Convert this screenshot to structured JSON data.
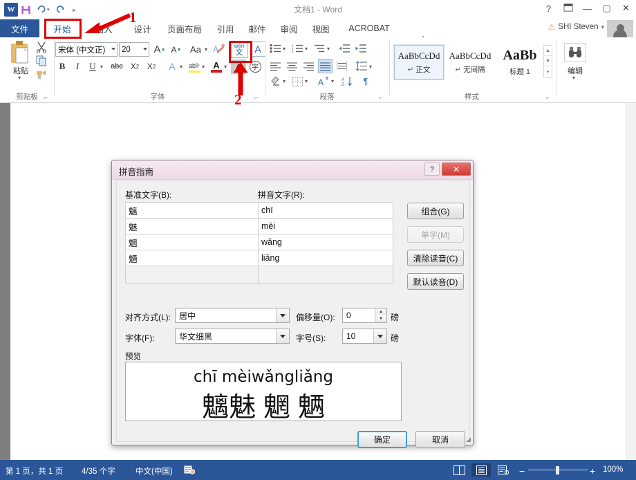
{
  "titlebar": {
    "app_logo": "W",
    "doc_title": "文档1 - Word",
    "qat": [
      {
        "name": "save",
        "glyph": "■"
      },
      {
        "name": "undo",
        "glyph": "↶"
      },
      {
        "name": "redo",
        "glyph": "↻"
      },
      {
        "name": "customize",
        "glyph": "≡"
      }
    ],
    "window_controls": [
      {
        "name": "help",
        "glyph": "?"
      },
      {
        "name": "ribbon-display-options",
        "glyph": "□"
      },
      {
        "name": "minimize",
        "glyph": "—"
      },
      {
        "name": "maximize",
        "glyph": "□"
      },
      {
        "name": "close",
        "glyph": "✕"
      }
    ]
  },
  "tabs": {
    "file": "文件",
    "items": [
      "开始",
      "插入",
      "设计",
      "页面布局",
      "引用",
      "邮件",
      "审阅",
      "视图",
      "ACROBAT"
    ],
    "active": "开始",
    "account_name": "SHI Steven",
    "account_caret": "▾"
  },
  "ribbon": {
    "groups": [
      {
        "name": "clipboard",
        "label": "剪贴板"
      },
      {
        "name": "font",
        "label": "字体"
      },
      {
        "name": "paragraph",
        "label": "段落"
      },
      {
        "name": "styles",
        "label": "样式"
      },
      {
        "name": "editing",
        "label": "编辑"
      }
    ],
    "clipboard": {
      "paste_label": "粘贴",
      "paste_caret": "▾",
      "cut_icon": "✂",
      "copy_icon": "⧉",
      "format_painter_icon": "✒"
    },
    "font": {
      "font_name": "宋体 (中文正)",
      "font_size": "20",
      "grow_font": "A",
      "shrink_font": "A",
      "change_case": "Aa",
      "clear_formatting": "✐",
      "phonetic_guide_top": "wén",
      "phonetic_guide_bottom": "文",
      "char_border": "A",
      "bold": "B",
      "italic": "I",
      "underline": "U",
      "strikethrough": "abc",
      "subscript": "X₂",
      "superscript": "X²",
      "text_effects": "A",
      "highlight": "ab",
      "font_color": "A",
      "char_shading": "A",
      "char_enclose": "字"
    },
    "paragraph": {
      "bullets": "≡",
      "numbering": "≡",
      "multilevel": "≡",
      "decrease_indent": "⇤",
      "increase_indent": "⇥",
      "align_left": "≡",
      "align_center": "≡",
      "align_right": "≡",
      "justify": "≡",
      "distribute": "≡",
      "line_spacing": "↕",
      "shading": "▧",
      "borders": "▦",
      "asian_layout": "A",
      "sort": "A↓",
      "show_marks": "¶"
    },
    "styles": {
      "items": [
        {
          "sample": "AaBbCcDd",
          "name": "正文",
          "mark": "↵",
          "selected": true
        },
        {
          "sample": "AaBbCcDd",
          "name": "无间隔",
          "mark": "↵",
          "selected": false
        },
        {
          "sample": "AaBb",
          "name": "标题 1",
          "mark": "",
          "selected": false
        }
      ],
      "scroll_up": "▲",
      "scroll_down": "▼",
      "scroll_more": "≣"
    },
    "editing": {
      "label": "编辑",
      "icon": "\u0001",
      "caret": "▾"
    },
    "collapse_icon": "⌃",
    "dialog_launcher": "⤡"
  },
  "document": {
    "selected_text": "魑魅魍魉",
    "paragraph_mark": "↵"
  },
  "dialog": {
    "title": "拼音指南",
    "help_btn": "?",
    "close_btn": "✕",
    "base_label": "基准文字(B):",
    "ruby_label": "拼音文字(R):",
    "rows": [
      {
        "base": "魑",
        "ruby": "chī"
      },
      {
        "base": "魅",
        "ruby": "mèi"
      },
      {
        "base": "魍",
        "ruby": "wǎng"
      },
      {
        "base": "魉",
        "ruby": "liǎng"
      },
      {
        "base": "",
        "ruby": ""
      }
    ],
    "buttons": [
      {
        "name": "combine",
        "label": "组合(G)",
        "disabled": false
      },
      {
        "name": "single-char",
        "label": "单字(M)",
        "disabled": true
      },
      {
        "name": "clear-reading",
        "label": "清除读音(C)",
        "disabled": false
      },
      {
        "name": "default-reading",
        "label": "默认读音(D)",
        "disabled": false
      }
    ],
    "align_label": "对齐方式(L):",
    "align_value": "居中",
    "offset_label": "偏移量(O):",
    "offset_value": "0",
    "offset_unit": "磅",
    "font_label": "字体(F):",
    "font_value": "华文细黑",
    "size_label": "字号(S):",
    "size_value": "10",
    "size_unit": "磅",
    "preview_label": "预览",
    "preview_pinyin": "chī mèiwǎngliǎng",
    "preview_text": "魑魅 魍 魉",
    "ok_label": "确定",
    "cancel_label": "取消"
  },
  "annotations": [
    {
      "name": "step-1",
      "label": "1"
    },
    {
      "name": "step-2",
      "label": "2"
    }
  ],
  "status": {
    "page": "第 1 页，共 1 页",
    "words": "4/35 个字",
    "language": "中文(中国)",
    "proofing_icon": "▤",
    "views": [
      {
        "name": "read-mode",
        "glyph": "▤"
      },
      {
        "name": "print-layout",
        "glyph": "▤",
        "selected": true
      },
      {
        "name": "web-layout",
        "glyph": "▤"
      }
    ],
    "zoom_out": "−",
    "zoom_in": "+",
    "zoom_level": "100%"
  },
  "colors": {
    "word_blue": "#2b579a",
    "accent_red": "#e00000",
    "dialog_pink": "#f0dfe9",
    "selection_gray": "#cdcdcd"
  }
}
